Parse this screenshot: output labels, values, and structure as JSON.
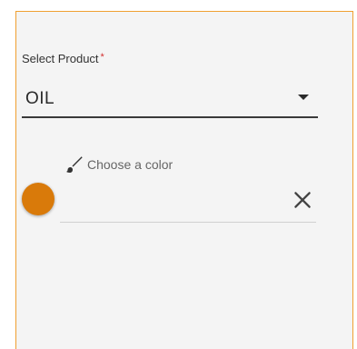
{
  "product_select": {
    "label": "Select Product",
    "required_marker": "*",
    "value": "OIL",
    "arrow_icon": "caret-down-icon"
  },
  "color_picker": {
    "label": "Choose a color",
    "label_icon": "paint-brush-icon",
    "selected_color": "#d97a0a",
    "clear_icon": "close-icon"
  },
  "theme": {
    "frame_border_color": "#f0a030",
    "required_color": "#d32f2f"
  }
}
